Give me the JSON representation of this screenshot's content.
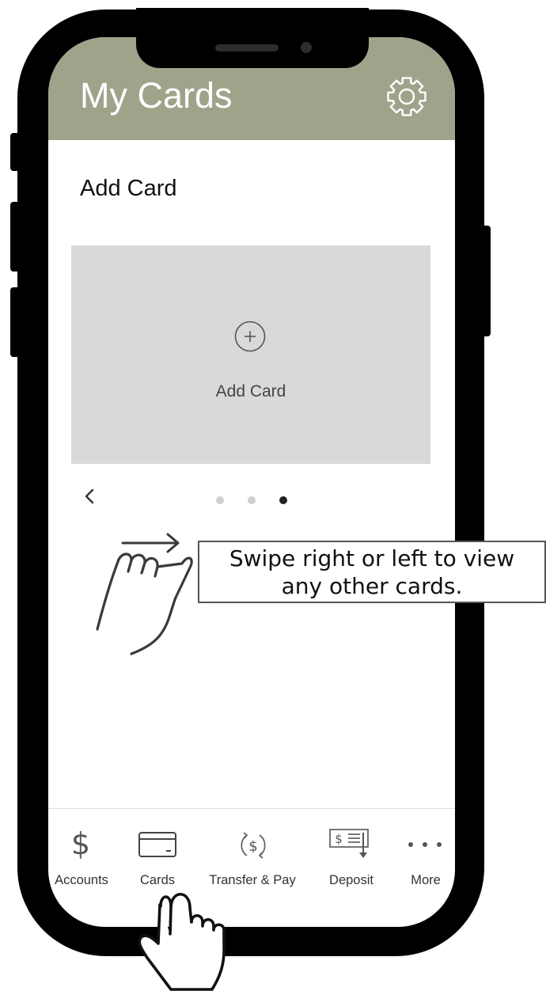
{
  "header": {
    "title": "My Cards",
    "settings_icon": "gear-icon",
    "background": "#a0a38a"
  },
  "section": {
    "title": "Add Card"
  },
  "card_tile": {
    "label": "Add Card",
    "icon": "plus-circle-icon"
  },
  "carousel": {
    "pages": 3,
    "active_page": 3,
    "prev_icon": "chevron-left-icon"
  },
  "callout": {
    "line1": "Swipe right or left to view",
    "line2": "any other cards."
  },
  "bottom_nav": {
    "items": [
      {
        "label": "Accounts",
        "icon": "dollar-icon"
      },
      {
        "label": "Cards",
        "icon": "card-icon"
      },
      {
        "label": "Transfer & Pay",
        "icon": "transfer-pay-icon"
      },
      {
        "label": "Deposit",
        "icon": "check-deposit-icon"
      },
      {
        "label": "More",
        "icon": "more-icon"
      }
    ]
  }
}
